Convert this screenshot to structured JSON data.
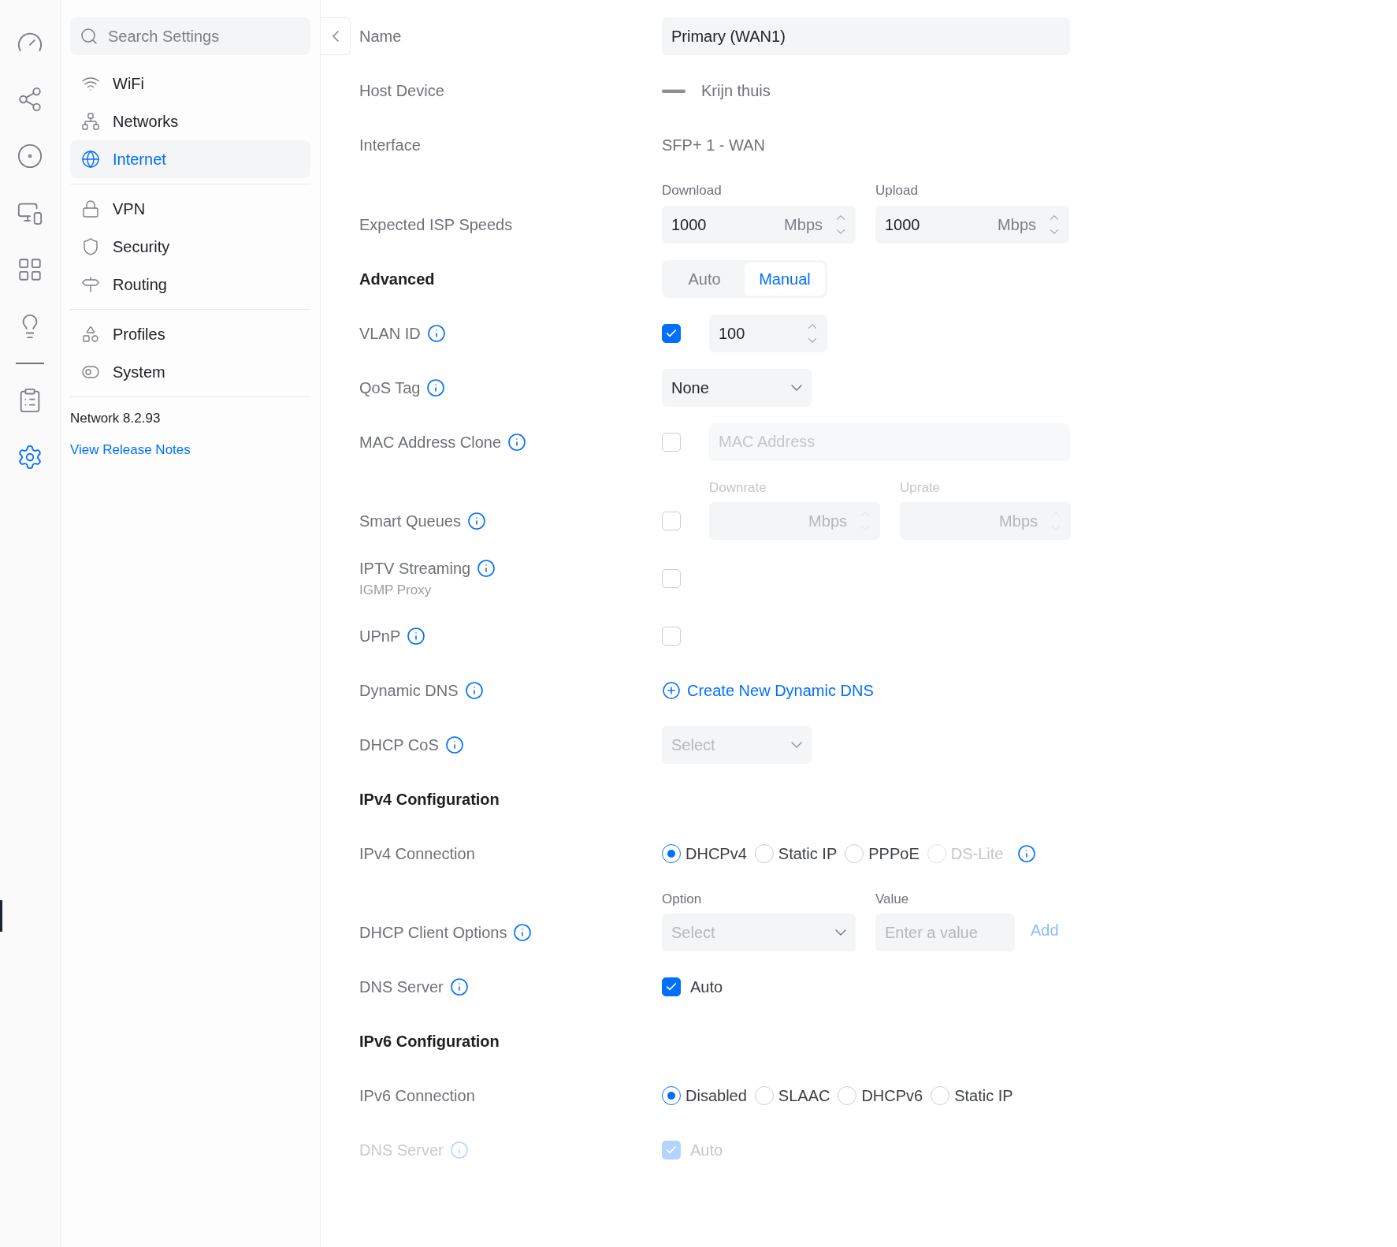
{
  "search": {
    "placeholder": "Search Settings"
  },
  "sidebar": {
    "groups": [
      [
        {
          "label": "WiFi",
          "selected": false
        },
        {
          "label": "Networks",
          "selected": false
        },
        {
          "label": "Internet",
          "selected": true
        }
      ],
      [
        {
          "label": "VPN",
          "selected": false
        },
        {
          "label": "Security",
          "selected": false
        },
        {
          "label": "Routing",
          "selected": false
        }
      ],
      [
        {
          "label": "Profiles",
          "selected": false
        },
        {
          "label": "System",
          "selected": false
        }
      ]
    ],
    "version": "Network 8.2.93",
    "link": "View Release Notes"
  },
  "rail": [
    {
      "selected": false
    },
    {
      "selected": false
    },
    {
      "selected": false
    },
    {
      "selected": false
    },
    {
      "selected": false
    },
    {
      "selected": false
    },
    {
      "selected": false
    },
    {
      "selected": true
    }
  ],
  "rows": [
    {
      "kind": "text-field",
      "label": "Name",
      "value": "Primary (WAN1)"
    },
    {
      "kind": "device",
      "label": "Host Device",
      "value": "Krijn thuis"
    },
    {
      "kind": "static",
      "label": "Interface",
      "value": "SFP+ 1 - WAN"
    },
    {
      "kind": "speeds",
      "label": "Expected ISP Speeds",
      "fields": [
        {
          "caption": "Download",
          "value": "1000",
          "unit": "Mbps"
        },
        {
          "caption": "Upload",
          "value": "1000",
          "unit": "Mbps"
        }
      ]
    },
    {
      "kind": "segmented",
      "label": "Advanced",
      "options": [
        {
          "label": "Auto",
          "selected": false
        },
        {
          "label": "Manual",
          "selected": true
        }
      ]
    },
    {
      "kind": "checkbox-number",
      "label": "VLAN ID",
      "info": true,
      "checked": true,
      "value": "100"
    },
    {
      "kind": "select",
      "label": "QoS Tag",
      "info": true,
      "value": "None",
      "disabled": false
    },
    {
      "kind": "checkbox-field",
      "label": "MAC Address Clone",
      "info": true,
      "checked": false,
      "placeholder": "MAC Address"
    },
    {
      "kind": "checkbox-speeds",
      "label": "Smart Queues",
      "info": true,
      "checked": false,
      "fields": [
        {
          "caption": "Downrate",
          "unit": "Mbps"
        },
        {
          "caption": "Uprate",
          "unit": "Mbps"
        }
      ]
    },
    {
      "kind": "checkbox",
      "label": "IPTV Streaming",
      "sublabel": "IGMP Proxy",
      "info": true,
      "checked": false
    },
    {
      "kind": "checkbox",
      "label": "UPnP",
      "info": true,
      "checked": false
    },
    {
      "kind": "link",
      "label": "Dynamic DNS",
      "info": true,
      "link": "Create New Dynamic DNS"
    },
    {
      "kind": "select",
      "label": "DHCP CoS",
      "info": true,
      "placeholder": "Select",
      "disabled": true
    },
    {
      "kind": "heading",
      "label": "IPv4 Configuration"
    },
    {
      "kind": "radio",
      "label": "IPv4 Connection",
      "options_info": true,
      "options": [
        {
          "label": "DHCPv4",
          "selected": true,
          "disabled": false
        },
        {
          "label": "Static IP",
          "selected": false,
          "disabled": false
        },
        {
          "label": "PPPoE",
          "selected": false,
          "disabled": false
        },
        {
          "label": "DS-Lite",
          "selected": false,
          "disabled": true
        }
      ]
    },
    {
      "kind": "client-options",
      "label": "DHCP Client Options",
      "info": true,
      "option": {
        "caption": "Option",
        "placeholder": "Select"
      },
      "value": {
        "caption": "Value",
        "placeholder": "Enter a value"
      },
      "action": "Add",
      "action_disabled": true
    },
    {
      "kind": "checkbox",
      "label": "DNS Server",
      "info": true,
      "checked": true,
      "text": "Auto"
    },
    {
      "kind": "heading",
      "label": "IPv6 Configuration"
    },
    {
      "kind": "radio",
      "label": "IPv6 Connection",
      "options": [
        {
          "label": "Disabled",
          "selected": true,
          "disabled": false
        },
        {
          "label": "SLAAC",
          "selected": false,
          "disabled": false
        },
        {
          "label": "DHCPv6",
          "selected": false,
          "disabled": false
        },
        {
          "label": "Static IP",
          "selected": false,
          "disabled": false
        }
      ]
    },
    {
      "kind": "checkbox",
      "label": "DNS Server",
      "info": true,
      "checked": true,
      "text": "Auto",
      "disabled": true
    }
  ]
}
